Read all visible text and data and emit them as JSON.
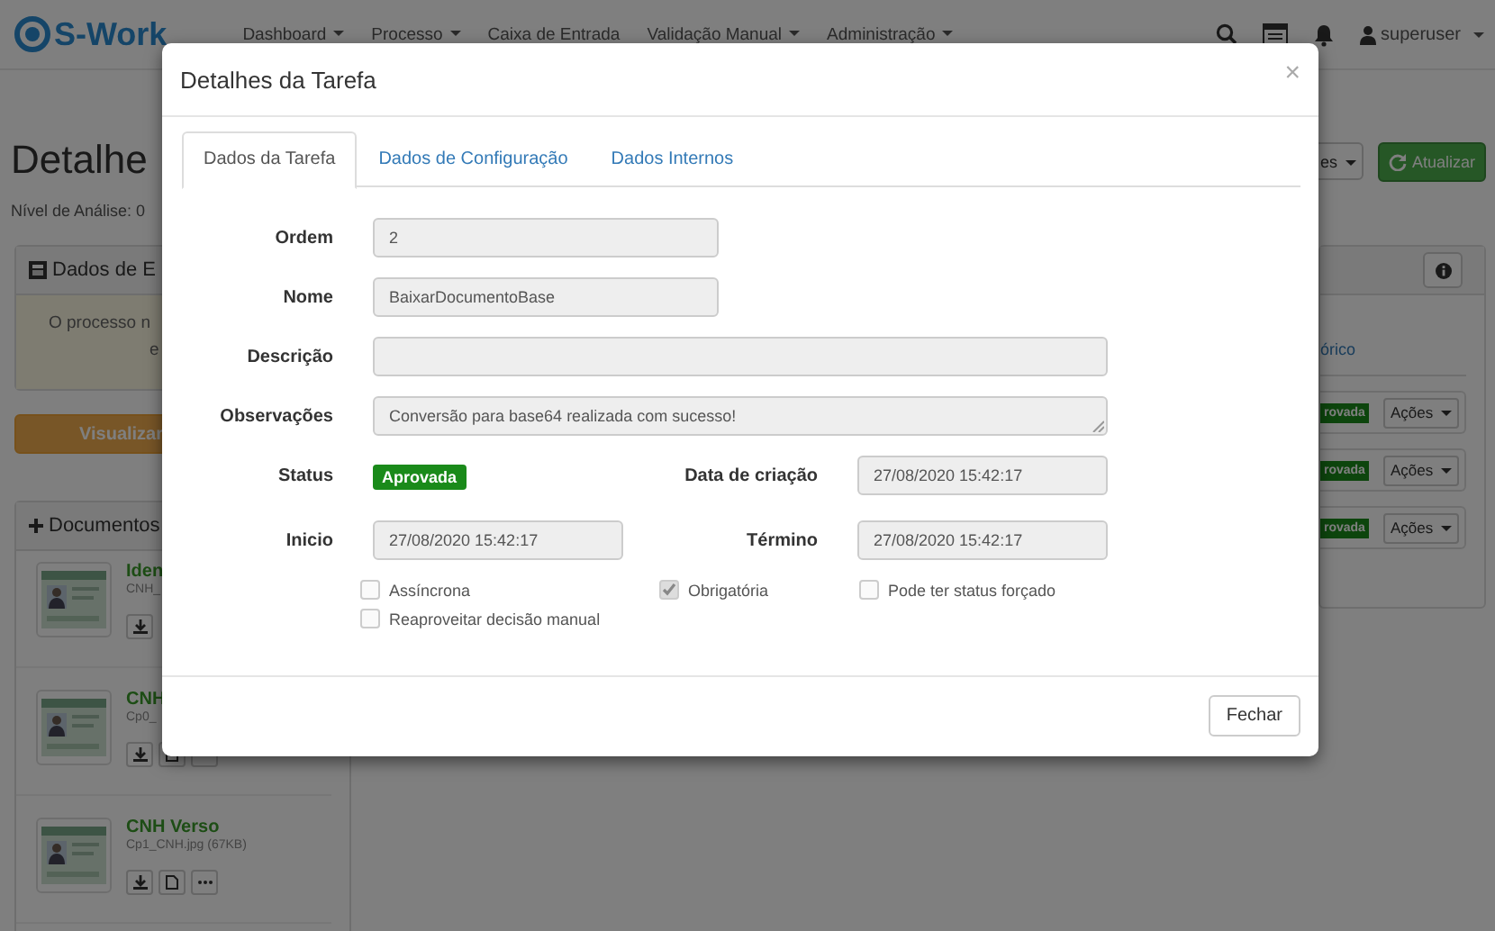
{
  "navbar": {
    "logo": "S-Work",
    "menu": [
      {
        "label": "Dashboard",
        "dropdown": true
      },
      {
        "label": "Processo",
        "dropdown": true
      },
      {
        "label": "Caixa de Entrada",
        "dropdown": false
      },
      {
        "label": "Validação Manual",
        "dropdown": true
      },
      {
        "label": "Administração",
        "dropdown": true
      }
    ],
    "user": "superuser"
  },
  "header": {
    "title": "Detalhe",
    "subtitle": "Nível de Análise: 0",
    "actions_button": "es",
    "refresh_button": "Atualizar"
  },
  "left": {
    "panel_title": "Dados de E",
    "panel_text": [
      "O processo n",
      "e"
    ],
    "view_button": "Visualizar",
    "documents_title": "Documentos",
    "documents": [
      {
        "name": "Iden",
        "file": "CNH_",
        "buttons": [
          {
            "kind": "download"
          }
        ]
      },
      {
        "name": "CNH",
        "file": "Cp0_",
        "buttons": [
          {
            "kind": "download"
          },
          {
            "kind": "file"
          },
          {
            "kind": "more"
          }
        ]
      },
      {
        "name": "CNH Verso",
        "file": "Cp1_CNH.jpg (67KB)",
        "buttons": [
          {
            "kind": "download"
          },
          {
            "kind": "file"
          },
          {
            "kind": "more"
          }
        ]
      }
    ]
  },
  "right": {
    "tab_label": "órico",
    "tasks": [
      {
        "status": "rovada",
        "button": "Ações"
      },
      {
        "status": "rovada",
        "button": "Ações"
      },
      {
        "status": "rovada",
        "button": "Ações"
      }
    ]
  },
  "modal": {
    "title": "Detalhes da Tarefa",
    "close": "×",
    "tabs": [
      {
        "label": "Dados da Tarefa",
        "selected": true
      },
      {
        "label": "Dados de Configuração",
        "selected": false
      },
      {
        "label": "Dados Internos",
        "selected": false
      }
    ],
    "rows": [
      [
        {
          "label": "Ordem",
          "kind": "short",
          "value": "2"
        }
      ],
      [
        {
          "label": "Nome",
          "kind": "short",
          "value": "BaixarDocumentoBase"
        }
      ],
      [
        {
          "label": "Descrição",
          "kind": "wide"
        }
      ],
      [
        {
          "label": "Observações",
          "kind": "textarea",
          "value": "Conversão para base64 realizada com sucesso!"
        }
      ],
      [
        {
          "label": "Status",
          "kind": "badge",
          "value": "Aprovada"
        },
        {
          "label": "Data de criação",
          "kind": "date",
          "value": "27/08/2020 15:42:17"
        }
      ],
      [
        {
          "label": "Inicio",
          "kind": "date",
          "value": "27/08/2020 15:42:17"
        },
        {
          "label": "Término",
          "kind": "date",
          "value": "27/08/2020 15:42:17"
        }
      ]
    ],
    "checkboxes": [
      {
        "label": "Assíncrona",
        "checked": false
      },
      {
        "label": "Obrigatória",
        "checked": true
      },
      {
        "label": "Pode ter status forçado",
        "checked": false
      },
      {
        "label": "Reaproveitar decisão manual",
        "checked": false
      }
    ],
    "footer_button": "Fechar"
  }
}
